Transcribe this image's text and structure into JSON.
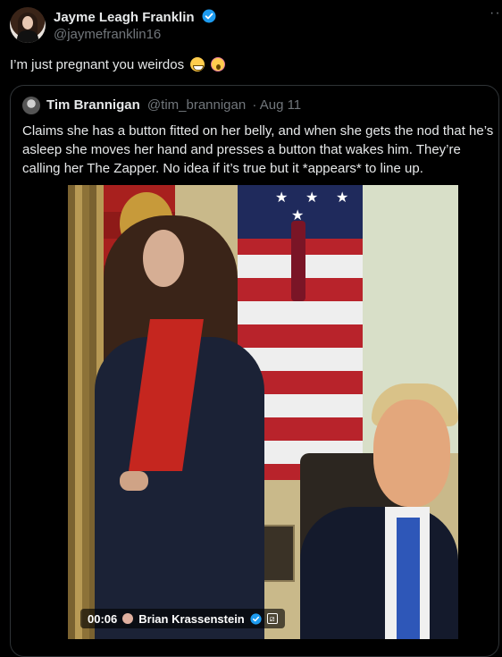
{
  "post": {
    "author_name": "Jayme Leagh Franklin",
    "author_handle": "@jaymefranklin16",
    "more_label": "···",
    "text": "I’m just pregnant you weirdos",
    "emojis": [
      "grinning-squinting-face",
      "face-screaming-in-fear"
    ]
  },
  "quote": {
    "author_name": "Tim Brannigan",
    "author_handle": "@tim_brannigan",
    "date": "· Aug 11",
    "text": "Claims she has a button fitted on her belly, and when she gets the nod that he’s asleep she moves her hand and presses a button that wakes him. They’re calling her The Zapper. No idea if it’s true but it *appears* to line up.",
    "video": {
      "time": "00:06",
      "source_name": "Brian Krassenstein"
    }
  },
  "colors": {
    "background": "#000000",
    "text_primary": "#e7e9ea",
    "text_secondary": "#71767b",
    "border": "#2f3336",
    "verified": "#1d9bf0"
  }
}
